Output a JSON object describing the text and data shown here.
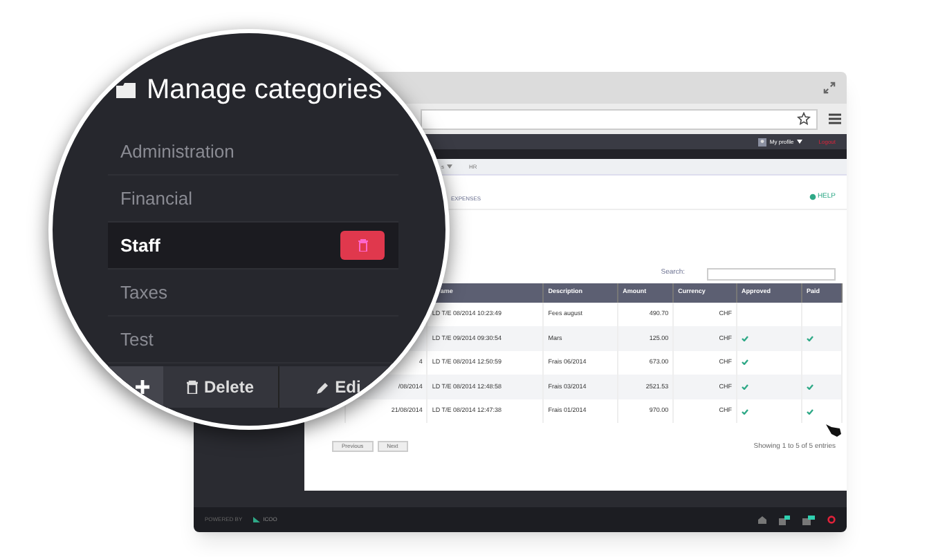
{
  "header": {
    "profile": "My profile",
    "logout": "Logout"
  },
  "nav": [
    {
      "label": "s",
      "dropdown": true
    },
    {
      "label": "HR",
      "dropdown": false
    }
  ],
  "page": {
    "title": "EXPENSES",
    "help": "HELP"
  },
  "search": {
    "label": "Search:"
  },
  "table": {
    "columns": [
      "",
      "",
      "ame",
      "Description",
      "Amount",
      "Currency",
      "Approved",
      "Paid"
    ],
    "rows": [
      {
        "date": "",
        "name": "LD T/E 08/2014 10:23:49",
        "description": "Fees august",
        "amount": "490.70",
        "currency": "CHF",
        "approved": false,
        "paid": false
      },
      {
        "date": "",
        "name": "LD T/E 09/2014 09:30:54",
        "description": "Mars",
        "amount": "125.00",
        "currency": "CHF",
        "approved": true,
        "paid": true
      },
      {
        "date": "4",
        "name": "LD T/E 08/2014 12:50:59",
        "description": "Frais 06/2014",
        "amount": "673.00",
        "currency": "CHF",
        "approved": true,
        "paid": false
      },
      {
        "date": "/08/2014",
        "name": "LD T/E 08/2014 12:48:58",
        "description": "Frais 03/2014",
        "amount": "2521.53",
        "currency": "CHF",
        "approved": true,
        "paid": true
      },
      {
        "date": "21/08/2014",
        "name": "LD T/E 08/2014 12:47:38",
        "description": "Frais 01/2014",
        "amount": "970.00",
        "currency": "CHF",
        "approved": true,
        "paid": true
      }
    ]
  },
  "pagination": {
    "previous": "Previous",
    "next": "Next",
    "info": "Showing 1 to 5 of 5 entries"
  },
  "footer": {
    "powered_by": "POWERED BY",
    "brand": "ICOO"
  },
  "magnifier": {
    "title": "Manage categories",
    "categories": [
      {
        "label": "Administration",
        "selected": false
      },
      {
        "label": "Financial",
        "selected": false
      },
      {
        "label": "Staff",
        "selected": true
      },
      {
        "label": "Taxes",
        "selected": false
      },
      {
        "label": "Test",
        "selected": false
      }
    ],
    "actions": {
      "delete": "Delete",
      "edit": "Edi"
    }
  }
}
